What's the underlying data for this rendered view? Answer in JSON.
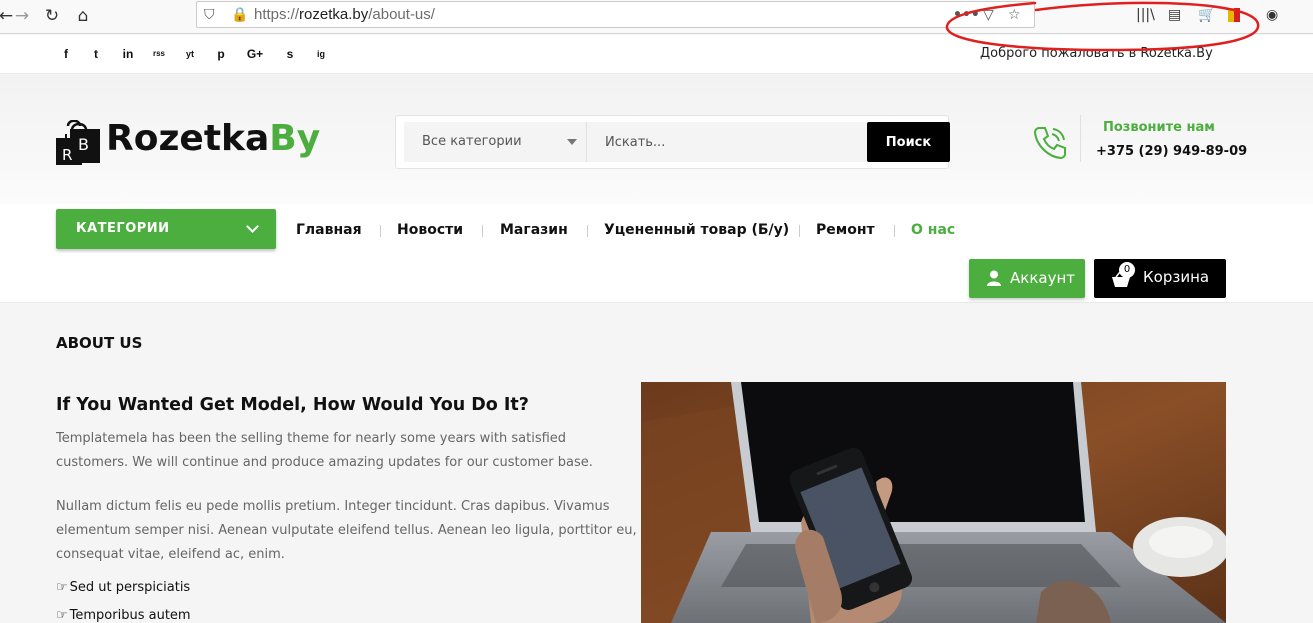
{
  "browser": {
    "url_prefix": "https://",
    "url_host": "rozetka.by",
    "url_path": "/about-us/"
  },
  "topbar": {
    "social_icons": [
      "facebook-icon",
      "twitter-icon",
      "linkedin-icon",
      "rss-icon",
      "youtube-icon",
      "pinterest-icon",
      "google-plus-icon",
      "skype-icon",
      "instagram-icon"
    ],
    "social_glyphs": [
      "f",
      "t",
      "in",
      "rss",
      "yt",
      "p",
      "G+",
      "s",
      "ig"
    ],
    "welcome": "Доброго пожаловать в Rozetka.By"
  },
  "header": {
    "logo_left": "Rozetka",
    "logo_right": "By",
    "search_category": "Все категории",
    "search_placeholder": "Искать...",
    "search_button": "Поиск",
    "call_label": "Позвоните нам",
    "call_number": "+375 (29) 949-89-09"
  },
  "menu": {
    "categories_label": "КАТЕГОРИИ",
    "items": [
      "Главная",
      "Новости",
      "Магазин",
      "Уцененный товар (Б/у)",
      "Ремонт",
      "О нас"
    ],
    "active_item": "О нас",
    "account_label": "Аккаунт",
    "cart_label": "Корзина",
    "cart_count": "0"
  },
  "content": {
    "page_title": "ABOUT US",
    "heading": "If You Wanted Get Model, How Would You Do It?",
    "paragraph1": "Templatemela has been the selling theme for nearly some years with satisfied customers. We will continue and produce amazing updates for our customer base.",
    "paragraph2": "Nullam dictum felis eu pede mollis pretium. Integer tincidunt. Cras dapibus. Vivamus elementum semper nisi. Aenean vulputate eleifend tellus. Aenean leo ligula, porttitor eu, consequat vitae, eleifend ac, enim.",
    "bullets": [
      "Sed ut perspiciatis",
      "Temporibus autem"
    ]
  },
  "colors": {
    "accent_green": "#4cae3e",
    "black": "#000000",
    "annotation_red": "#e0201e"
  }
}
